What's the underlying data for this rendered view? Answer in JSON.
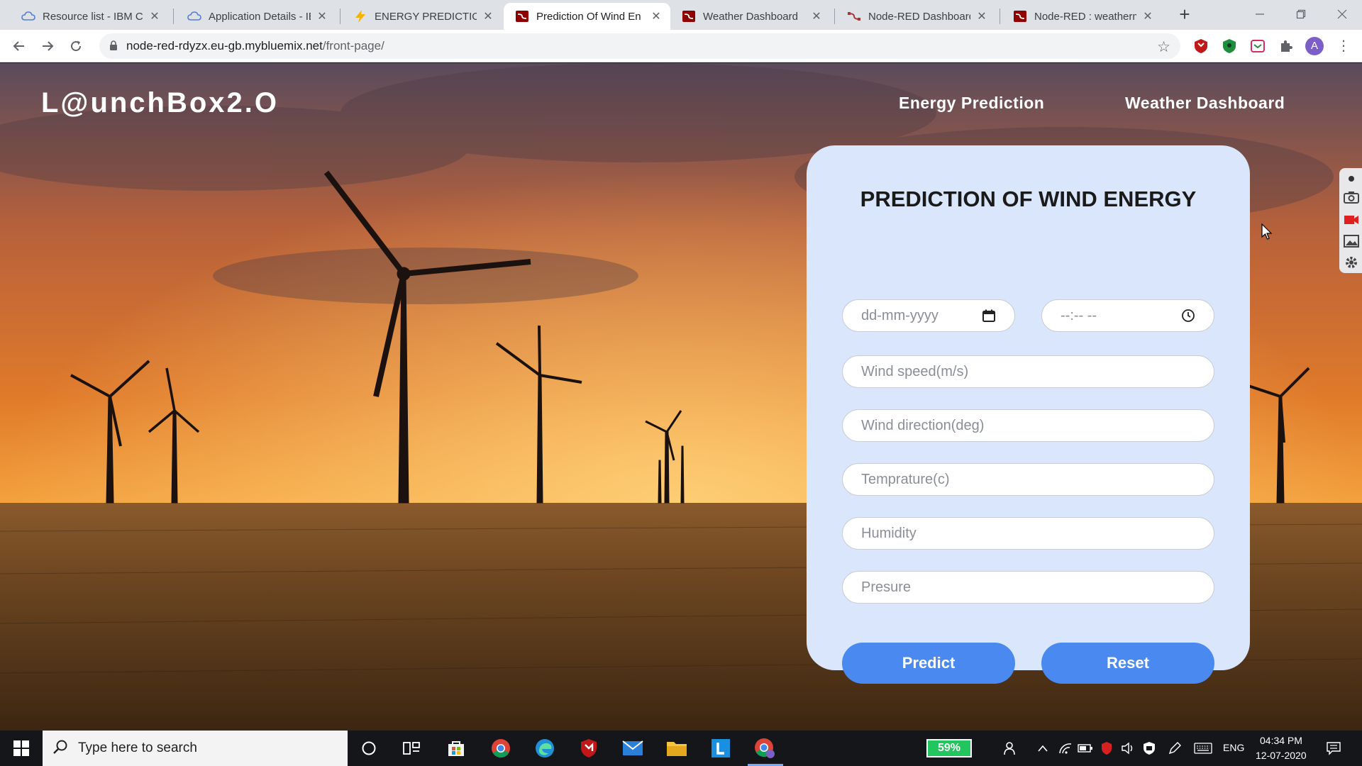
{
  "browser": {
    "tabs": [
      {
        "title": "Resource list - IBM Clo",
        "favicon": "ibm-cloud-icon",
        "active": false
      },
      {
        "title": "Application Details - IB",
        "favicon": "ibm-cloud-icon",
        "active": false
      },
      {
        "title": "ENERGY PREDICTION",
        "favicon": "lightning-icon",
        "active": false
      },
      {
        "title": "Prediction Of Wind En",
        "favicon": "node-red-icon",
        "active": true
      },
      {
        "title": "Weather Dashboard",
        "favicon": "node-red-icon",
        "active": false
      },
      {
        "title": "Node-RED Dashboard",
        "favicon": "node-red-icon",
        "active": false
      },
      {
        "title": "Node-RED : weatherm",
        "favicon": "node-red-icon",
        "active": false
      }
    ],
    "url_host": "node-red-rdyzx.eu-gb.mybluemix.net",
    "url_path": "/front-page/",
    "profile_initial": "A"
  },
  "page": {
    "brand": "L@unchBox2.O",
    "nav": [
      {
        "label": "Energy Prediction"
      },
      {
        "label": "Weather Dashboard"
      }
    ],
    "form": {
      "title": "PREDICTION OF WIND ENERGY",
      "date_placeholder": "dd-mm-yyyy",
      "time_placeholder": "--:-- --",
      "fields": [
        {
          "placeholder": "Wind speed(m/s)"
        },
        {
          "placeholder": "Wind direction(deg)"
        },
        {
          "placeholder": "Temprature(c)"
        },
        {
          "placeholder": "Humidity"
        },
        {
          "placeholder": "Presure"
        }
      ],
      "predict_label": "Predict",
      "reset_label": "Reset"
    }
  },
  "taskbar": {
    "search_placeholder": "Type here to search",
    "battery": "59%",
    "language": "ENG",
    "time": "04:34 PM",
    "date": "12-07-2020"
  },
  "colors": {
    "card_bg": "#d9e6fb",
    "button": "#4a8af0",
    "tab_strip": "#dee1e6"
  }
}
